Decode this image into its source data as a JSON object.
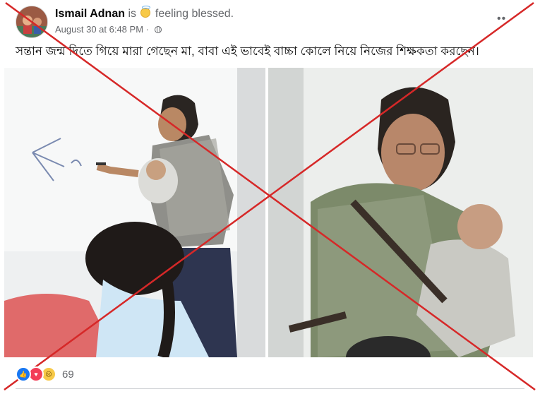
{
  "post": {
    "author": "Ismail Adnan",
    "activity_prefix": "is",
    "activity_icon": "halo-smile-emoji-icon",
    "activity_text": "feeling blessed.",
    "timestamp": "August 30 at 6:48 PM",
    "separator": "·",
    "audience_icon": "globe-icon",
    "caption": "সন্তান জন্ম দিতে গিয়ে মারা গেছেন মা, বাবা এই ভাবেই বাচ্চা কোলে নিয়ে নিজের শিক্ষকতা করছেন।"
  },
  "reactions": {
    "icons": [
      "like-reaction-icon",
      "love-reaction-icon",
      "sad-reaction-icon"
    ],
    "count": "69"
  },
  "overlay": {
    "type": "red-x-false-claim-mark",
    "color": "#d62828"
  },
  "colors": {
    "text_primary": "#050505",
    "text_secondary": "#65676b",
    "like_blue": "#1877f2",
    "love_red": "#f33e58",
    "sad_yellow": "#f7c948"
  }
}
